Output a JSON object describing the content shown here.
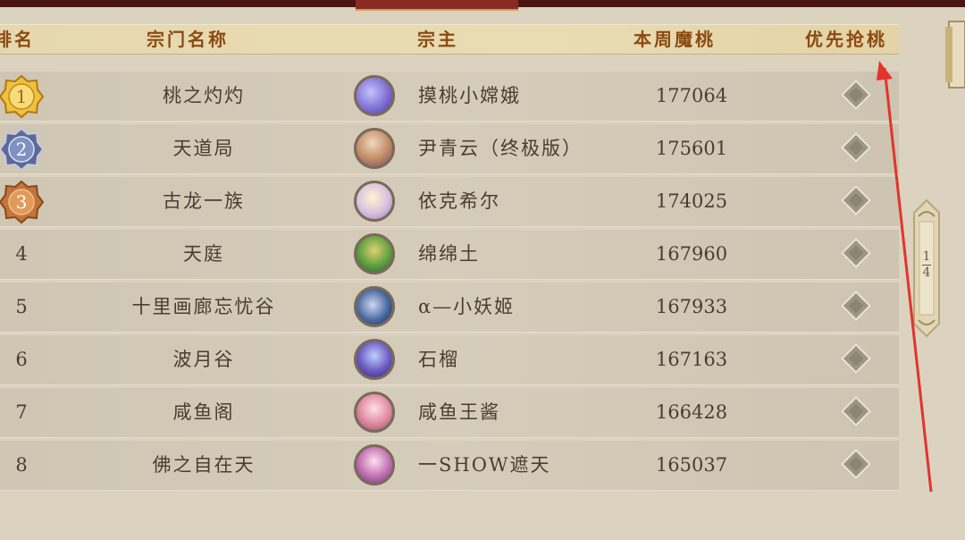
{
  "header": {
    "rank": "排名",
    "guild": "宗门名称",
    "leader": "宗主",
    "score": "本周魔桃",
    "priority": "优先抢桃"
  },
  "rows": [
    {
      "rank": "1",
      "guild": "桃之灼灼",
      "leader": "摸桃小嫦娥",
      "score": "177064",
      "medal": "gold"
    },
    {
      "rank": "2",
      "guild": "天道局",
      "leader": "尹青云（终极版）",
      "score": "175601",
      "medal": "silver"
    },
    {
      "rank": "3",
      "guild": "古龙一族",
      "leader": "依克希尔",
      "score": "174025",
      "medal": "bronze"
    },
    {
      "rank": "4",
      "guild": "天庭",
      "leader": "绵绵土",
      "score": "167960"
    },
    {
      "rank": "5",
      "guild": "十里画廊忘忧谷",
      "leader": "α—小妖姬",
      "score": "167933"
    },
    {
      "rank": "6",
      "guild": "波月谷",
      "leader": "石榴",
      "score": "167163"
    },
    {
      "rank": "7",
      "guild": "咸鱼阁",
      "leader": "咸鱼王酱",
      "score": "166428"
    },
    {
      "rank": "8",
      "guild": "佛之自在天",
      "leader": "一SHOW遮天",
      "score": "165037"
    }
  ],
  "pagination": {
    "current": "1",
    "total": "4"
  },
  "colors": {
    "header_text": "#8a4a10",
    "row_text": "#4a3d33",
    "gold": "#e8b63a",
    "silver": "#5a6a9a",
    "bronze": "#c4743a",
    "arrow": "#e2342c"
  }
}
